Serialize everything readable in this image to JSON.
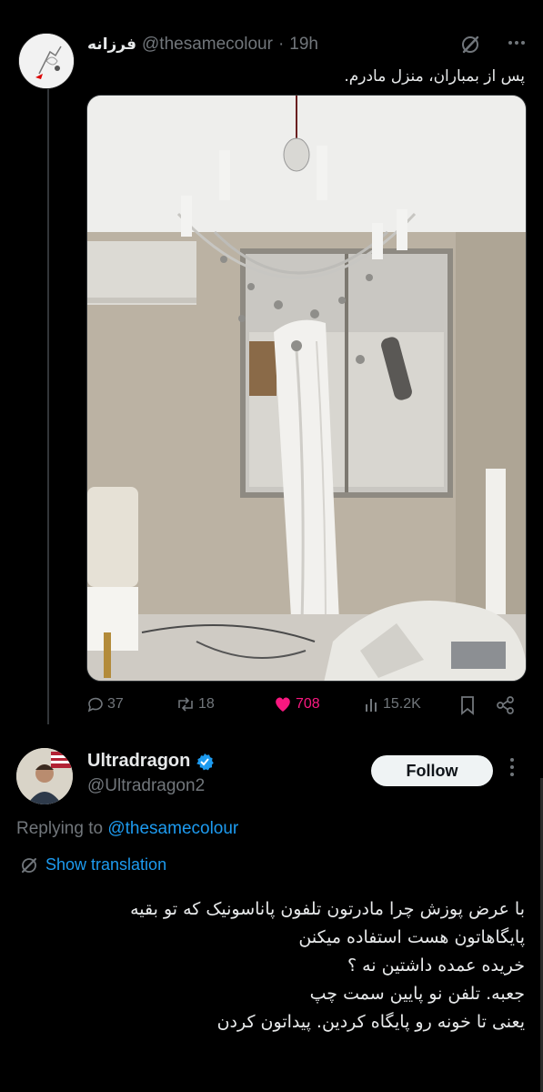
{
  "tweet": {
    "author_name": "فرزانه",
    "handle": "@thesamecolour",
    "separator": "·",
    "time": "19h",
    "text": "پس از بمباران، منزل مادرم.",
    "stats": {
      "replies": "37",
      "reposts": "18",
      "likes": "708",
      "views": "15.2K"
    },
    "icons": [
      "grok-icon",
      "more-icon",
      "reply-icon",
      "repost-icon",
      "like-icon",
      "views-icon",
      "bookmark-icon",
      "share-icon"
    ],
    "like_color": "#f91880"
  },
  "reply": {
    "author_name": "Ultradragon",
    "handle": "@Ultradragon2",
    "follow_label": "Follow",
    "replying_prefix": "Replying to",
    "replying_to": "@thesamecolour",
    "translation_label": "Show translation",
    "lines": [
      "با عرض پوزش چرا   مادرتون تلفون پاناسونیک که تو بقیه",
      "پایگاهاتون هست استفاده میکنن",
      "خریده عمده داشتین نه ؟",
      "جعبه. تلفن نو پایین سمت چپ",
      "یعنی تا خونه رو پایگاه کردین. پیداتون کردن"
    ],
    "verified_color": "#1d9bf0"
  },
  "theme": {
    "background": "#000000",
    "text": "#e7e9ea",
    "muted": "#71767b",
    "accent": "#1d9bf0"
  }
}
